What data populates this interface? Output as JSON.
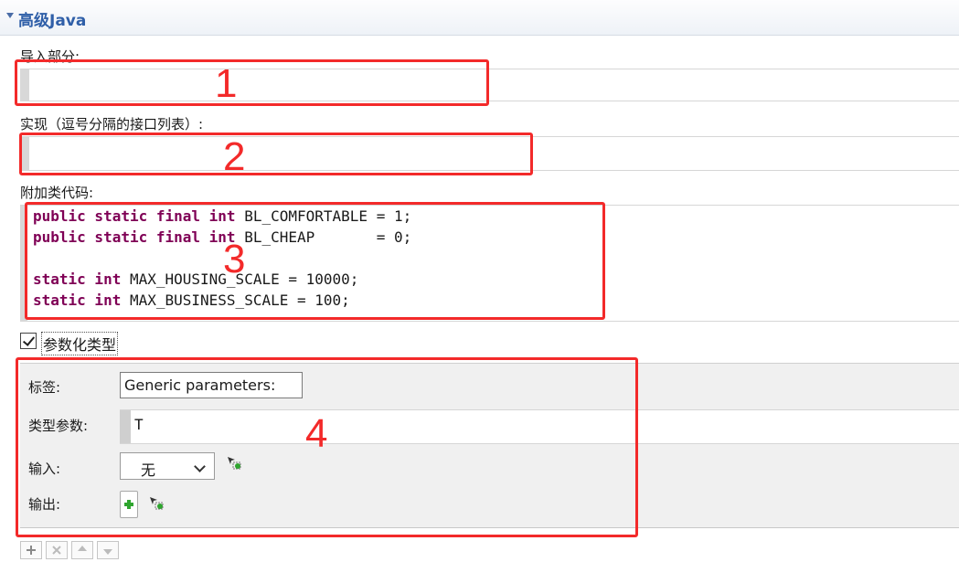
{
  "section": {
    "title": "高级Java"
  },
  "imports": {
    "label": "导入部分:",
    "value": ""
  },
  "implements": {
    "label": "实现（逗号分隔的接口列表）:",
    "value": ""
  },
  "extra_code": {
    "label": "附加类代码:",
    "lines": [
      {
        "kw": "public static final int",
        "rest": " BL_COMFORTABLE = 1;"
      },
      {
        "kw": "public static final int",
        "rest": " BL_CHEAP       = 0;"
      },
      {
        "kw": "",
        "rest": ""
      },
      {
        "kw": "static int",
        "rest": " MAX_HOUSING_SCALE = 10000;"
      },
      {
        "kw": "static int",
        "rest": " MAX_BUSINESS_SCALE = 100;"
      }
    ]
  },
  "parameterized": {
    "label": "参数化类型",
    "checked": true
  },
  "params": {
    "label_label": "标签:",
    "label_value": "Generic parameters:",
    "type_params_label": "类型参数:",
    "type_params_value": "T",
    "input_label": "输入:",
    "input_value": "无",
    "output_label": "输出:"
  },
  "annotations": [
    "1",
    "2",
    "3",
    "4"
  ],
  "icons": {
    "collapse": "triangle-down-icon",
    "type_select": "cursor-select-icon",
    "add": "plus-icon"
  }
}
